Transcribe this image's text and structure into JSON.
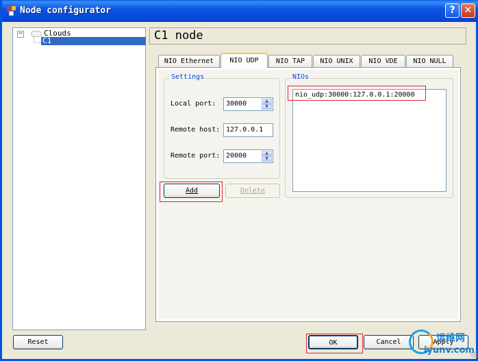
{
  "window": {
    "title": "Node configurator",
    "help_btn": "?",
    "close_btn": "✕"
  },
  "tree": {
    "expander": "−",
    "root_label": "Clouds",
    "child_label": "C1"
  },
  "node_title": "C1 node",
  "tabs": [
    {
      "label": "NIO Ethernet",
      "active": false
    },
    {
      "label": "NIO UDP",
      "active": true
    },
    {
      "label": "NIO TAP",
      "active": false
    },
    {
      "label": "NIO UNIX",
      "active": false
    },
    {
      "label": "NIO VDE",
      "active": false
    },
    {
      "label": "NIO NULL",
      "active": false
    }
  ],
  "settings": {
    "group_title": "Settings",
    "local_port_label": "Local port:",
    "local_port_value": "30000",
    "remote_host_label": "Remote host:",
    "remote_host_value": "127.0.0.1",
    "remote_port_label": "Remote port:",
    "remote_port_value": "20000"
  },
  "nios": {
    "group_title": "NIOs",
    "items": [
      "nio_udp:30000:127.0.0.1:20000"
    ]
  },
  "buttons": {
    "add": "Add",
    "delete": "Delete",
    "reset": "Reset",
    "ok": "OK",
    "cancel": "Cancel",
    "apply": "Apply"
  },
  "watermark": {
    "top": "运维网",
    "bottom": "iyunv.com"
  },
  "colors": {
    "titlebar": "#0b56df",
    "highlight_box": "#e0262c",
    "selection": "#316ac5",
    "group_title": "#0046d5"
  }
}
